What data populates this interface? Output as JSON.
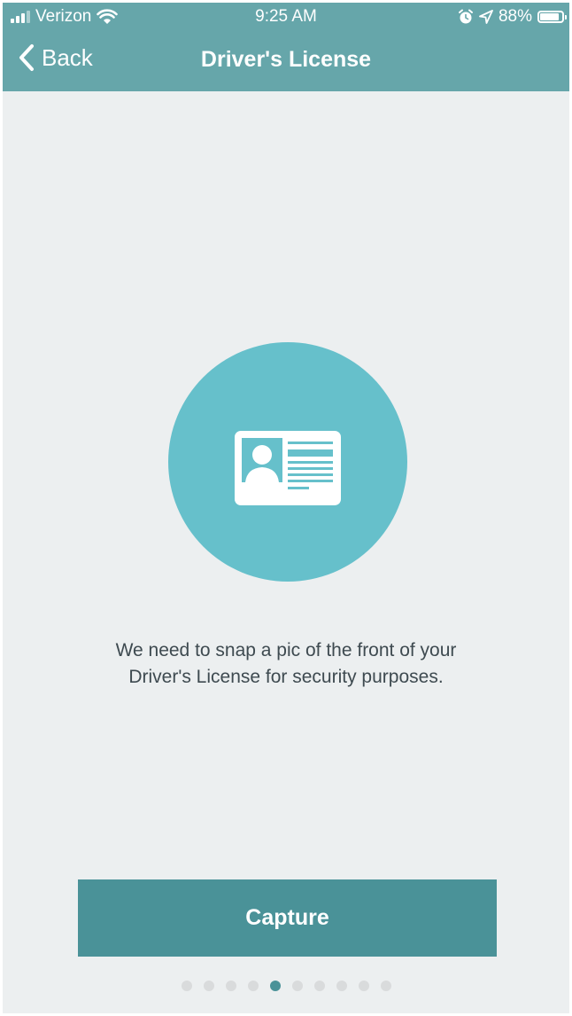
{
  "status_bar": {
    "carrier": "Verizon",
    "time": "9:25 AM",
    "battery": "88%",
    "battery_level": 0.88
  },
  "nav": {
    "back_label": "Back",
    "title": "Driver's License"
  },
  "hero": {
    "icon": "id-card-icon",
    "circle_color": "#66c0cb"
  },
  "message": {
    "line1": "We need to snap a pic of the front of your",
    "line2": "Driver's License for security purposes."
  },
  "actions": {
    "capture_label": "Capture"
  },
  "pagination": {
    "total": 10,
    "current": 5
  },
  "colors": {
    "header": "#66a6aa",
    "button": "#4a9298",
    "background": "#eceff0"
  }
}
